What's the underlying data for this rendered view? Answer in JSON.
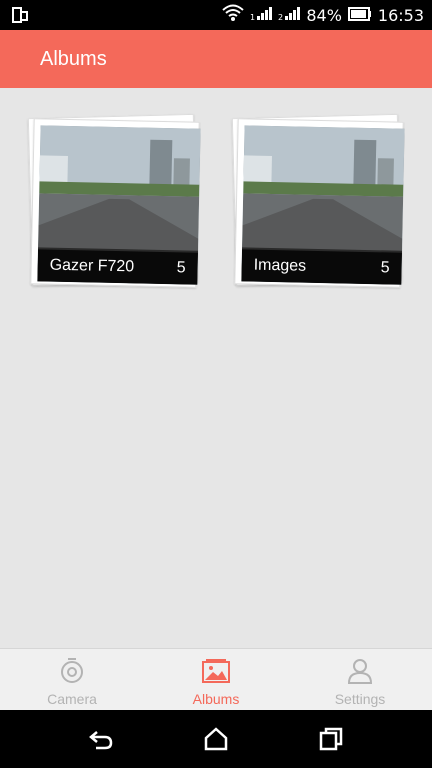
{
  "status": {
    "battery": "84%",
    "time": "16:53"
  },
  "appbar": {
    "title": "Albums"
  },
  "albums": [
    {
      "name": "Gazer F720",
      "count": "5"
    },
    {
      "name": "Images",
      "count": "5"
    }
  ],
  "bottom_nav": [
    {
      "label": "Camera",
      "icon": "camera-icon",
      "active": false
    },
    {
      "label": "Albums",
      "icon": "image-icon",
      "active": true
    },
    {
      "label": "Settings",
      "icon": "person-icon",
      "active": false
    }
  ],
  "colors": {
    "accent": "#f4695a",
    "inactive": "#b3b3b3"
  }
}
